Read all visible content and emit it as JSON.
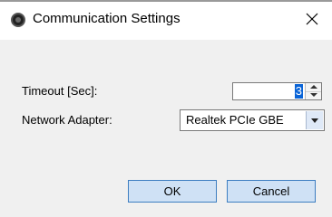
{
  "window": {
    "title": "Communication Settings",
    "close_symbol": "✕"
  },
  "form": {
    "timeout": {
      "label": "Timeout [Sec]:",
      "value": "3"
    },
    "network_adapter": {
      "label": "Network Adapter:",
      "value": "Realtek PCIe GBE"
    }
  },
  "buttons": {
    "ok_label": "OK",
    "cancel_label": "Cancel"
  },
  "icons": {
    "app": "app-icon",
    "close": "close-icon",
    "spin_up": "arrow-up-icon",
    "spin_down": "arrow-down-icon",
    "dropdown": "chevron-down-icon"
  },
  "colors": {
    "accent": "#0a64d7",
    "button_bg": "#cfe1f5",
    "button_border": "#3e7ec1"
  }
}
